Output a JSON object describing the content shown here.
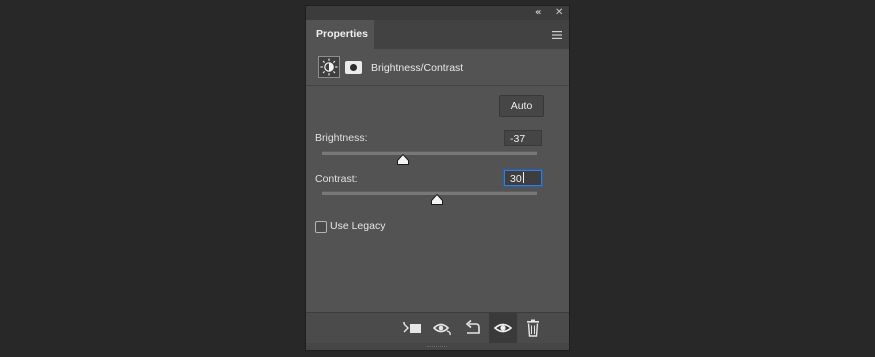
{
  "window": {
    "collapse_glyph": "«",
    "close_glyph": "✕"
  },
  "panel": {
    "tab_label": "Properties",
    "menu_icon": "hamburger-menu-icon"
  },
  "layer": {
    "adjustment_icon": "brightness-contrast-icon",
    "mask_icon": "layer-mask-icon",
    "title": "Brightness/Contrast"
  },
  "controls": {
    "auto_label": "Auto",
    "brightness": {
      "label": "Brightness:",
      "value": "-37",
      "min": -150,
      "max": 150
    },
    "contrast": {
      "label": "Contrast:",
      "value": "30",
      "min": -50,
      "max": 100
    },
    "use_legacy": {
      "label": "Use Legacy",
      "checked": false
    }
  },
  "toolbar": {
    "icons": [
      "clip-to-layer-icon",
      "view-previous-state-icon",
      "reset-icon",
      "toggle-visibility-icon",
      "delete-icon"
    ]
  },
  "colors": {
    "panel_bg": "#535353",
    "focus_ring": "#3b7bd4"
  }
}
